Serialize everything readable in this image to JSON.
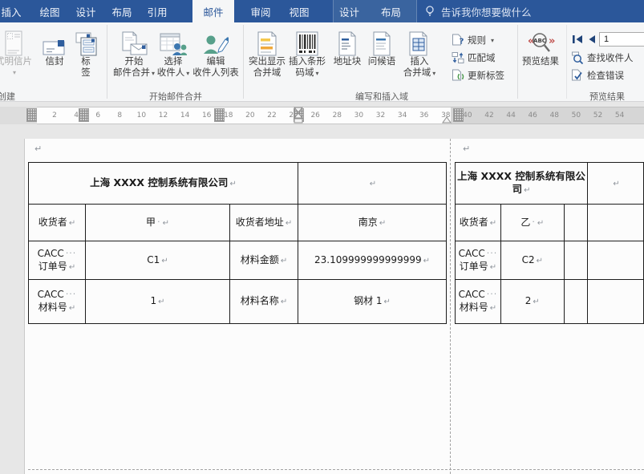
{
  "tab_bar": {
    "tabs": [
      {
        "label": "插入"
      },
      {
        "label": "绘图"
      },
      {
        "label": "设计"
      },
      {
        "label": "布局"
      },
      {
        "label": "引用"
      },
      {
        "label": "邮件"
      },
      {
        "label": "审阅"
      },
      {
        "label": "视图"
      }
    ],
    "active_tab": "邮件",
    "contextual_tabs": [
      {
        "label": "设计"
      },
      {
        "label": "布局"
      }
    ],
    "tell_me": "告诉我你想要做什么"
  },
  "ribbon": {
    "groups": {
      "create": {
        "label": "创建"
      },
      "start_mail_merge": {
        "label": "开始邮件合并"
      },
      "write_insert_fields": {
        "label": "编写和插入域"
      },
      "preview_results": {
        "label": "预览结果"
      }
    },
    "buttons": {
      "postcard": {
        "label": "式明信片",
        "dropdown": "▾"
      },
      "envelope": {
        "label": "信封"
      },
      "labels": {
        "line1": "标",
        "line2": "签"
      },
      "start_mail_merge": {
        "line1": "开始",
        "line2": "邮件合并",
        "dropdown": "▾"
      },
      "select_recipients": {
        "line1": "选择",
        "line2": "收件人",
        "dropdown": "▾"
      },
      "edit_recipient_list": {
        "line1": "编辑",
        "line2": "收件人列表"
      },
      "highlight_merge_fields": {
        "line1": "突出显示",
        "line2": "合并域"
      },
      "insert_barcode_field": {
        "line1": "插入条形",
        "line2": "码域",
        "dropdown": "▾"
      },
      "address_block": {
        "label": "地址块"
      },
      "greeting_line": {
        "label": "问候语"
      },
      "insert_merge_field": {
        "line1": "插入",
        "line2": "合并域",
        "dropdown": "▾"
      },
      "rules": {
        "label": "规则",
        "dropdown": "▾"
      },
      "match_fields": {
        "label": "匹配域"
      },
      "update_labels": {
        "label": "更新标签"
      },
      "preview_results": {
        "label": "预览结果"
      },
      "find_recipient": {
        "label": "查找收件人"
      },
      "check_errors": {
        "label": "检查错误"
      }
    },
    "record_navigator": {
      "value": "1"
    }
  },
  "ruler": {
    "numbers": [
      "2",
      "4",
      "6",
      "8",
      "10",
      "12",
      "14",
      "16",
      "18",
      "20",
      "22",
      "24",
      "26",
      "28",
      "30",
      "32",
      "34",
      "36",
      "38",
      "40",
      "42",
      "44",
      "46",
      "48",
      "50",
      "52",
      "54"
    ]
  },
  "marks": {
    "para": "↵",
    "space": "·",
    "spaces": "···"
  },
  "document": {
    "label1": {
      "company": "上海 XXXX 控制系统有限公司",
      "consignee_label": "收货者",
      "consignee": "甲",
      "address_label": "收货者地址",
      "address": "南京",
      "order_label_l1": "CACC",
      "order_label_l2": "订单号",
      "order_no": "C1",
      "amount_label": "材料金额",
      "amount": "23.109999999999999",
      "material_label_l1": "CACC",
      "material_label_l2": "材料号",
      "material_no": "1",
      "material_name_label": "材料名称",
      "material_name": "钢材 1"
    },
    "label2": {
      "company": "上海 XXXX 控制系统有限公司",
      "consignee_label": "收货者",
      "consignee": "乙",
      "order_label_l1": "CACC",
      "order_label_l2": "订单号",
      "order_no": "C2",
      "material_label_l1": "CACC",
      "material_label_l2": "材料号",
      "material_no": "2"
    }
  },
  "colors": {
    "accent": "#2b579a",
    "ribbon_bg": "#f5f6f7",
    "doc_bg": "#e7e7e7"
  }
}
